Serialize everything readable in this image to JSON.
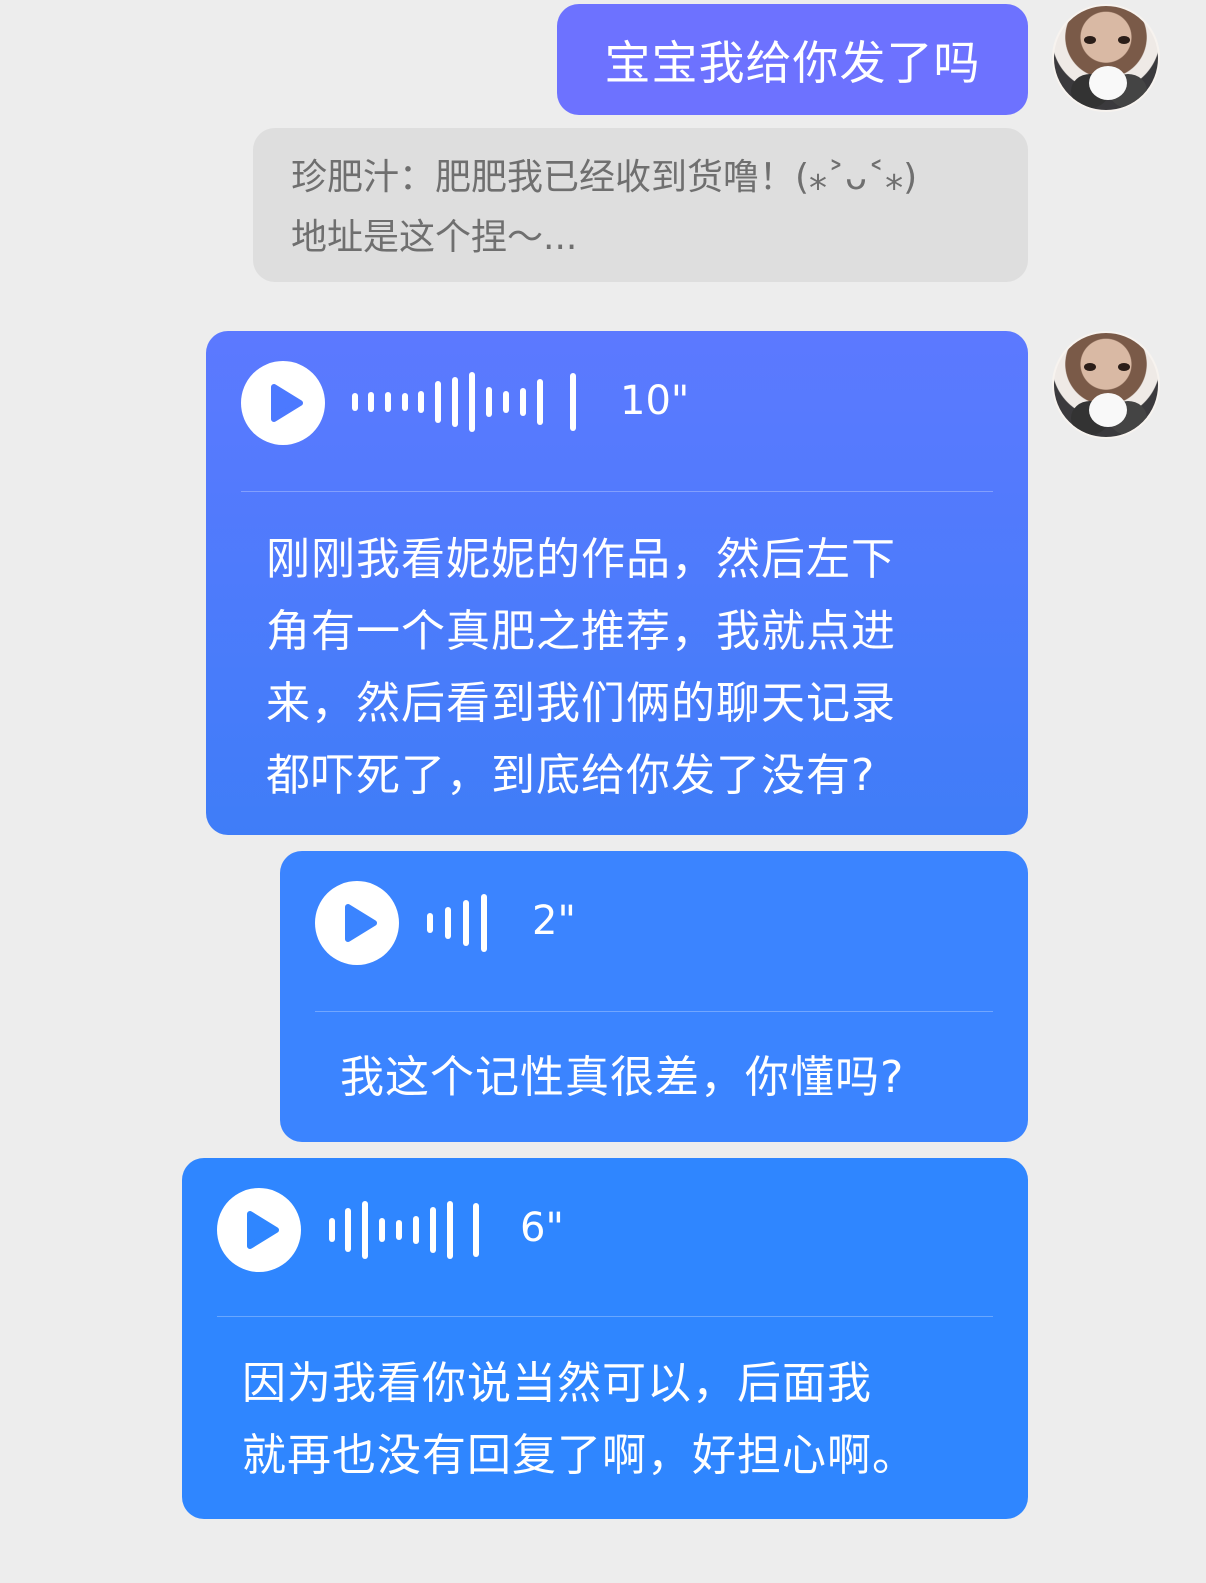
{
  "messages": [
    {
      "type": "text",
      "text": "宝宝我给你发了吗",
      "color": "#6d72ff"
    },
    {
      "type": "quote",
      "lines": [
        "珍肥汁：肥肥我已经收到货噜！(⁎˃ᴗ˂⁎)",
        "地址是这个捏～..."
      ]
    },
    {
      "type": "voice",
      "duration": "10\"",
      "transcript_lines": [
        "刚刚我看妮妮的作品，然后左下",
        "角有一个真肥之推荐，我就点进",
        "来，然后看到我们俩的聊天记录",
        "都吓死了，到底给你发了没有?"
      ],
      "color": "#4f7bff"
    },
    {
      "type": "voice",
      "duration": "2\"",
      "transcript_lines": [
        "我这个记性真很差，你懂吗?"
      ],
      "color": "#3b84ff"
    },
    {
      "type": "voice",
      "duration": "6\"",
      "transcript_lines": [
        "因为我看你说当然可以，后面我",
        "就再也没有回复了啊，好担心啊。"
      ],
      "color": "#2f86ff"
    }
  ],
  "icons": {
    "play": "play-icon",
    "waveform": "voice-waveform-icon",
    "avatar": "user-avatar"
  }
}
